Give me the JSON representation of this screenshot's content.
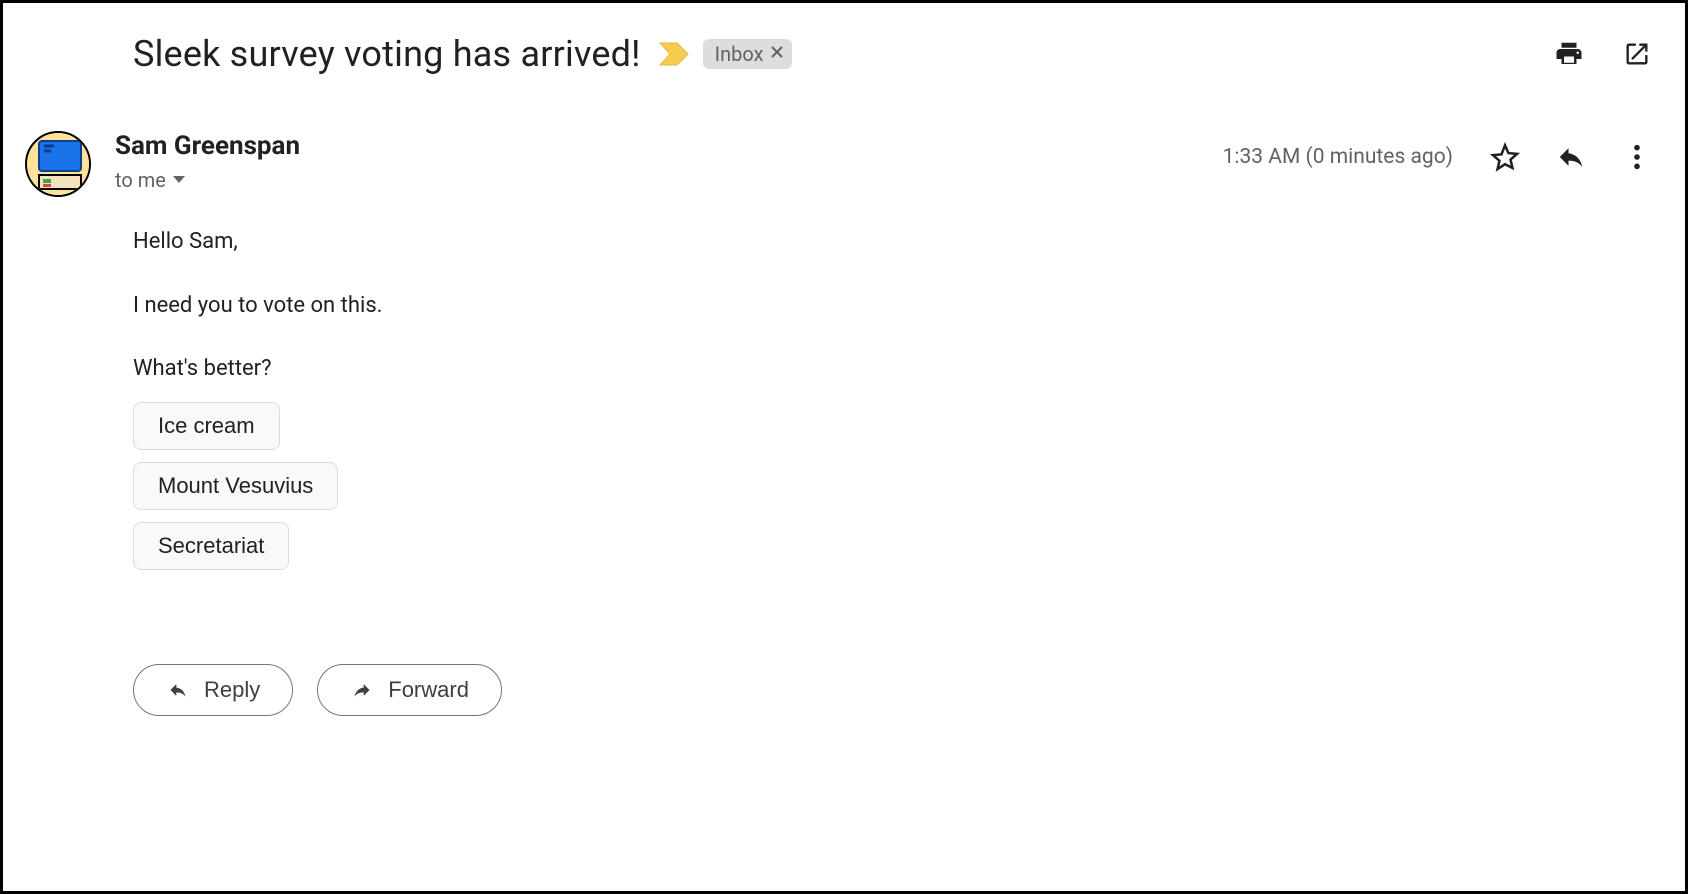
{
  "subject": "Sleek survey voting has arrived!",
  "label": "Inbox",
  "sender": {
    "name": "Sam Greenspan",
    "to_line": "to me"
  },
  "timestamp": "1:33 AM (0 minutes ago)",
  "body": {
    "greeting": "Hello Sam,",
    "line1": "I need you to vote on this.",
    "question": "What's better?",
    "options": [
      "Ice cream",
      "Mount Vesuvius",
      "Secretariat"
    ]
  },
  "actions": {
    "reply": "Reply",
    "forward": "Forward"
  }
}
